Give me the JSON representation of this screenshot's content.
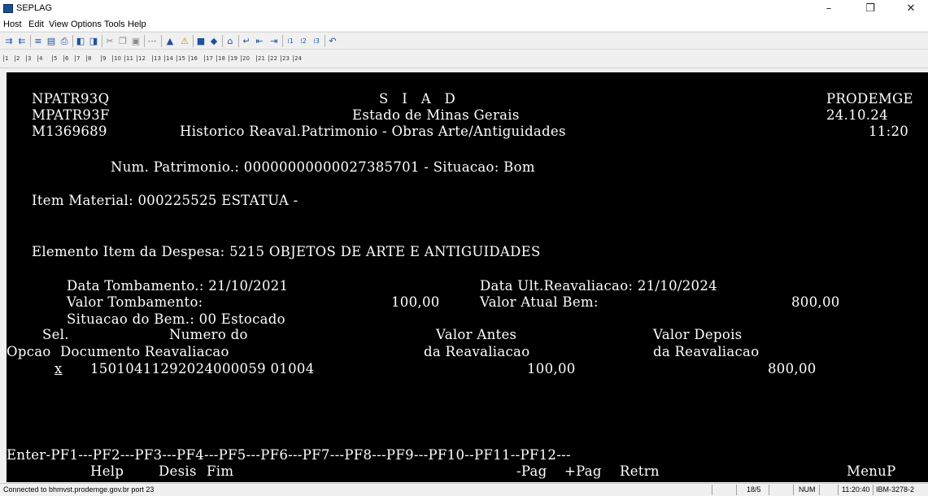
{
  "window": {
    "title": "SEPLAG",
    "minimize": "–",
    "maximize": "❐",
    "close": "✕"
  },
  "menu": [
    "Host",
    "Edit",
    "View",
    "Options",
    "Tools",
    "Help"
  ],
  "pf_keys": [
    "1",
    "2",
    "3",
    "4",
    "5",
    "6",
    "7",
    "8",
    "9",
    "10",
    "11",
    "12",
    "13",
    "14",
    "15",
    "16",
    "17",
    "18",
    "19",
    "20",
    "21",
    "22",
    "23",
    "24"
  ],
  "screen": {
    "prog1": "NPATR93Q",
    "prog2": "MPATR93F",
    "user": "M1369689",
    "system": "S   I   A   D",
    "state": "Estado de Minas Gerais",
    "title": "Historico Reaval.Patrimonio - Obras Arte/Antiguidades",
    "org": "PRODEMGE",
    "date": "24.10.24",
    "time": "11:20",
    "num_patrimonio_line": "Num. Patrimonio.: 00000000000027385701 - Situacao: Bom",
    "item_material_line": "Item Material: 000225525 ESTATUA -",
    "elemento_line": "Elemento Item da Despesa: 5215 OBJETOS DE ARTE E ANTIGUIDADES",
    "data_tombamento_line": "Data Tombamento.: 21/10/2021",
    "data_ult_reav_line": "Data Ult.Reavaliacao: 21/10/2024",
    "valor_tombamento_label": "Valor Tombamento:",
    "valor_tombamento": "100,00",
    "valor_atual_label": "Valor Atual Bem:",
    "valor_atual": "800,00",
    "situacao_bem_line": "Situacao do Bem.: 00 Estocado",
    "col_sel": "Sel.",
    "col_opcao": "Opcao",
    "col_numero_1": "Numero do",
    "col_numero_2": "Documento Reavaliacao",
    "col_antes_1": "Valor Antes",
    "col_antes_2": "da Reavaliacao",
    "col_depois_1": "Valor Depois",
    "col_depois_2": "da Reavaliacao",
    "row": {
      "sel": "x",
      "documento": "15010411292024000059 01004",
      "antes": "100,00",
      "depois": "800,00"
    },
    "pf_line": "Enter-PF1---PF2---PF3---PF4---PF5---PF6---PF7---PF8---PF9---PF10--PF11--PF12---",
    "pf_help": "Help",
    "pf_desis": "Desis",
    "pf_fim": "Fim",
    "pf_pag_minus": "-Pag",
    "pf_pag_plus": "+Pag",
    "pf_retrn": "Retrn",
    "pf_menup": "MenuP"
  },
  "status": {
    "connection": "Connected to bhmvst.prodemge.gov.br port 23",
    "cursor": "18/5",
    "num": "NUM",
    "clock": "11:20:40",
    "terminal": "IBM-3278-2"
  }
}
